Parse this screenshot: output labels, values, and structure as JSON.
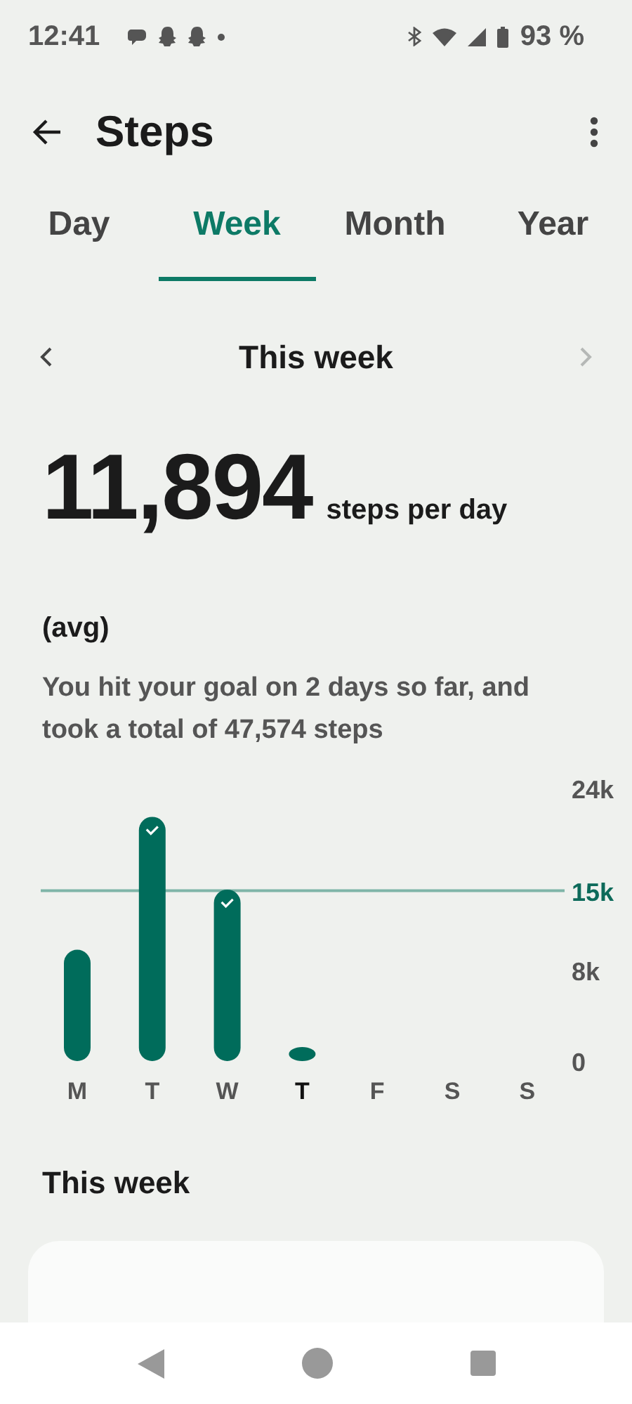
{
  "status_bar": {
    "time": "12:41",
    "battery": "93 %"
  },
  "app_bar": {
    "title": "Steps"
  },
  "tabs": [
    {
      "label": "Day",
      "selected": false
    },
    {
      "label": "Week",
      "selected": true
    },
    {
      "label": "Month",
      "selected": false
    },
    {
      "label": "Year",
      "selected": false
    }
  ],
  "period": {
    "label": "This week",
    "next_disabled": true
  },
  "summary": {
    "value": "11,894",
    "unit": "steps per day",
    "note": "(avg)",
    "description": "You hit your goal on 2 days so far, and took a total of 47,574 steps"
  },
  "chart": {
    "today_selected": [
      false,
      false,
      false,
      true,
      false,
      false,
      false
    ],
    "chart_data": {
      "type": "bar",
      "categories": [
        "M",
        "T",
        "W",
        "T",
        "F",
        "S",
        "S"
      ],
      "values": [
        9800,
        21500,
        15100,
        1000,
        null,
        null,
        null
      ],
      "ylim": [
        0,
        24000
      ],
      "yticks": [
        {
          "value": 0,
          "label": "0"
        },
        {
          "value": 8000,
          "label": "8k"
        },
        {
          "value": 15000,
          "label": "15k"
        },
        {
          "value": 24000,
          "label": "24k"
        }
      ],
      "ref_lines": [
        {
          "axis": "y",
          "value": 15000
        }
      ]
    }
  },
  "section": {
    "title": "This week"
  }
}
